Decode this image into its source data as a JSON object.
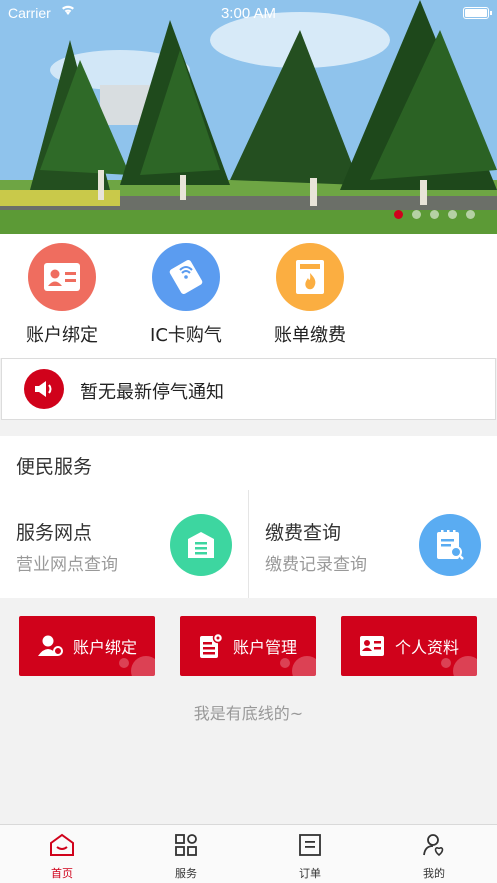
{
  "status_bar": {
    "carrier": "Carrier",
    "time": "3:00 AM"
  },
  "banner": {
    "slide_count": 5,
    "active_index": 0
  },
  "quick_actions": [
    {
      "label": "账户绑定",
      "icon": "id-card-icon",
      "color": "#ef6d5f"
    },
    {
      "label": "IC卡购气",
      "icon": "ic-card-icon",
      "color": "#5b9cf0"
    },
    {
      "label": "账单缴费",
      "icon": "bill-fire-icon",
      "color": "#fbae41"
    }
  ],
  "notice": {
    "text": "暂无最新停气通知",
    "icon": "megaphone-icon"
  },
  "services": {
    "title": "便民服务",
    "cards": [
      {
        "name": "服务网点",
        "desc": "营业网点查询",
        "icon": "outlet-icon",
        "color": "#3dd6a0"
      },
      {
        "name": "缴费查询",
        "desc": "缴费记录查询",
        "icon": "payment-record-icon",
        "color": "#5aacf2"
      }
    ]
  },
  "red_buttons": [
    {
      "label": "账户绑定",
      "icon": "user-bind-icon"
    },
    {
      "label": "账户管理",
      "icon": "account-manage-icon"
    },
    {
      "label": "个人资料",
      "icon": "profile-card-icon"
    }
  ],
  "footer_text": "我是有底线的~",
  "tabs": [
    {
      "label": "首页",
      "icon": "home-icon",
      "active": true
    },
    {
      "label": "服务",
      "icon": "services-grid-icon",
      "active": false
    },
    {
      "label": "订单",
      "icon": "orders-icon",
      "active": false
    },
    {
      "label": "我的",
      "icon": "me-icon",
      "active": false
    }
  ],
  "colors": {
    "brand_red": "#d0021b",
    "muted_text": "#999999"
  }
}
